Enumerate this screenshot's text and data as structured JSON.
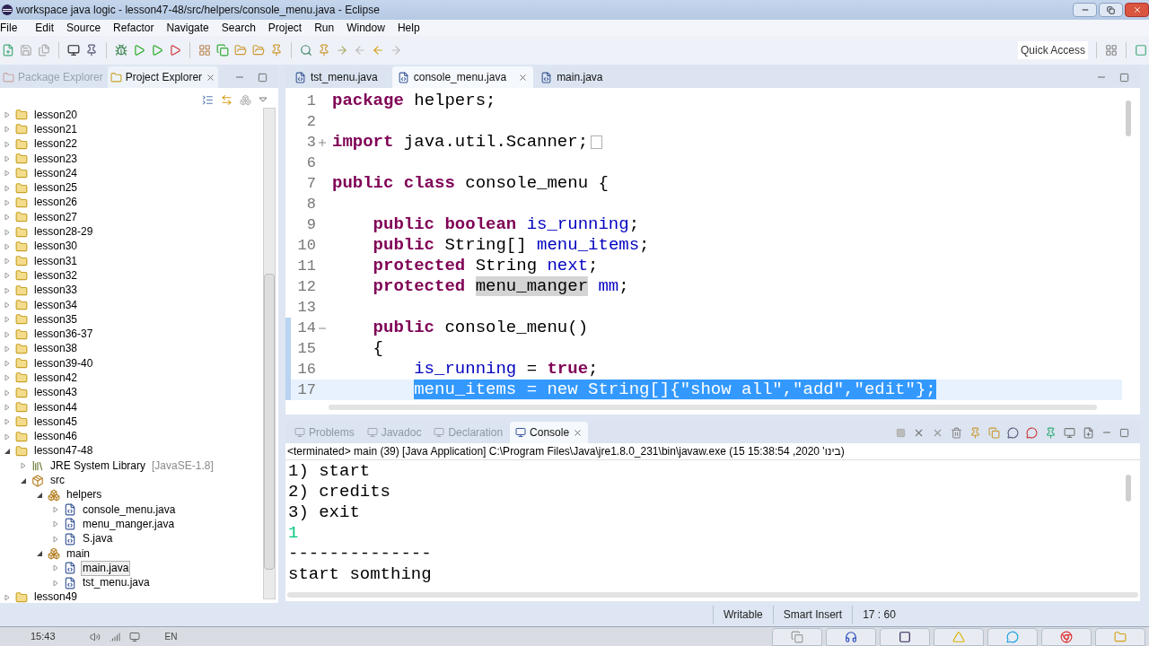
{
  "window": {
    "title": "workspace java logic - lesson47-48/src/helpers/console_menu.java - Eclipse"
  },
  "menu": [
    "File",
    "Edit",
    "Source",
    "Refactor",
    "Navigate",
    "Search",
    "Project",
    "Run",
    "Window",
    "Help"
  ],
  "toolbar": {
    "quick_access": "Quick Access"
  },
  "explorer": {
    "tabs": [
      {
        "label": "Package Explorer",
        "selected": false
      },
      {
        "label": "Project Explorer",
        "selected": true
      }
    ],
    "tree": [
      {
        "label": "lesson20",
        "kind": "project",
        "expanded": false
      },
      {
        "label": "lesson21",
        "kind": "project",
        "expanded": false
      },
      {
        "label": "lesson22",
        "kind": "project",
        "expanded": false
      },
      {
        "label": "lesson23",
        "kind": "project",
        "expanded": false
      },
      {
        "label": "lesson24",
        "kind": "project",
        "expanded": false
      },
      {
        "label": "lesson25",
        "kind": "project",
        "expanded": false
      },
      {
        "label": "lesson26",
        "kind": "project",
        "expanded": false
      },
      {
        "label": "lesson27",
        "kind": "project",
        "expanded": false
      },
      {
        "label": "lesson28-29",
        "kind": "project",
        "expanded": false
      },
      {
        "label": "lesson30",
        "kind": "project",
        "expanded": false
      },
      {
        "label": "lesson31",
        "kind": "project",
        "expanded": false
      },
      {
        "label": "lesson32",
        "kind": "project",
        "expanded": false
      },
      {
        "label": "lesson33",
        "kind": "project",
        "expanded": false
      },
      {
        "label": "lesson34",
        "kind": "project",
        "expanded": false
      },
      {
        "label": "lesson35",
        "kind": "project",
        "expanded": false
      },
      {
        "label": "lesson36-37",
        "kind": "project",
        "expanded": false
      },
      {
        "label": "lesson38",
        "kind": "project",
        "expanded": false
      },
      {
        "label": "lesson39-40",
        "kind": "project",
        "expanded": false
      },
      {
        "label": "lesson42",
        "kind": "project",
        "expanded": false
      },
      {
        "label": "lesson43",
        "kind": "project",
        "expanded": false
      },
      {
        "label": "lesson44",
        "kind": "project",
        "expanded": false
      },
      {
        "label": "lesson45",
        "kind": "project",
        "expanded": false
      },
      {
        "label": "lesson46",
        "kind": "project",
        "expanded": false
      },
      {
        "label": "lesson47-48",
        "kind": "project",
        "expanded": true,
        "children": [
          {
            "label": "JRE System Library",
            "decoration": "[JavaSE-1.8]",
            "kind": "library",
            "expanded": false
          },
          {
            "label": "src",
            "kind": "source",
            "expanded": true,
            "children": [
              {
                "label": "helpers",
                "kind": "package",
                "expanded": true,
                "children": [
                  {
                    "label": "console_menu.java",
                    "kind": "file",
                    "expanded": false,
                    "selected": false
                  },
                  {
                    "label": "menu_manger.java",
                    "kind": "file",
                    "expanded": false,
                    "selected": false
                  },
                  {
                    "label": "S.java",
                    "kind": "file",
                    "expanded": false,
                    "selected": false
                  }
                ]
              },
              {
                "label": "main",
                "kind": "package",
                "expanded": true,
                "children": [
                  {
                    "label": "main.java",
                    "kind": "file",
                    "expanded": false,
                    "selected": true
                  },
                  {
                    "label": "tst_menu.java",
                    "kind": "file",
                    "expanded": false,
                    "selected": false
                  }
                ]
              }
            ]
          }
        ]
      },
      {
        "label": "lesson49",
        "kind": "project",
        "expanded": false
      }
    ]
  },
  "editor": {
    "tabs": [
      {
        "label": "tst_menu.java",
        "selected": false
      },
      {
        "label": "console_menu.java",
        "selected": true
      },
      {
        "label": "main.java",
        "selected": false
      }
    ],
    "lines": [
      {
        "number": "1",
        "tokens": [
          {
            "text": "package",
            "kind": "keyword"
          },
          {
            "text": " helpers;",
            "kind": "plain"
          }
        ]
      },
      {
        "number": "2"
      },
      {
        "number": "3",
        "folded": true,
        "collapsed_box": true,
        "tokens": [
          {
            "text": "import",
            "kind": "keyword"
          },
          {
            "text": " java.util.Scanner;",
            "kind": "plain"
          }
        ]
      },
      {
        "number": "6"
      },
      {
        "number": "7",
        "tokens": [
          {
            "text": "public class",
            "kind": "keyword"
          },
          {
            "text": " console_menu {",
            "kind": "plain"
          }
        ]
      },
      {
        "number": "8"
      },
      {
        "number": "9",
        "tokens": [
          {
            "text": "    public boolean ",
            "kind": "keyword"
          },
          {
            "text": "is_running",
            "kind": "field"
          },
          {
            "text": ";",
            "kind": "plain"
          }
        ]
      },
      {
        "number": "10",
        "tokens": [
          {
            "text": "    public",
            "kind": "keyword"
          },
          {
            "text": " String[] ",
            "kind": "plain"
          },
          {
            "text": "menu_items",
            "kind": "field"
          },
          {
            "text": ";",
            "kind": "plain"
          }
        ]
      },
      {
        "number": "11",
        "tokens": [
          {
            "text": "    protected",
            "kind": "keyword"
          },
          {
            "text": " String ",
            "kind": "plain"
          },
          {
            "text": "next",
            "kind": "field"
          },
          {
            "text": ";",
            "kind": "plain"
          }
        ]
      },
      {
        "number": "12",
        "tokens": [
          {
            "text": "    protected ",
            "kind": "keyword"
          },
          {
            "text": "menu_manger",
            "kind": "occurrence"
          },
          {
            "text": " mm",
            "kind": "field"
          },
          {
            "text": ";",
            "kind": "plain"
          }
        ]
      },
      {
        "number": "13"
      },
      {
        "number": "14",
        "folded": false,
        "changed": true,
        "tokens": [
          {
            "text": "    public",
            "kind": "keyword"
          },
          {
            "text": " console_menu()",
            "kind": "plain"
          }
        ]
      },
      {
        "number": "15",
        "changed": true,
        "tokens": [
          {
            "text": "    {",
            "kind": "plain"
          }
        ]
      },
      {
        "number": "16",
        "changed": true,
        "tokens": [
          {
            "text": "        is_running",
            "kind": "field"
          },
          {
            "text": " = ",
            "kind": "plain"
          },
          {
            "text": "true",
            "kind": "keyword"
          },
          {
            "text": ";",
            "kind": "plain"
          }
        ]
      },
      {
        "number": "17",
        "changed": true,
        "current": true,
        "tokens": [
          {
            "text": "        menu_items = new String[]{\"show all\",\"add\",\"edit\"};",
            "kind": "selection"
          }
        ]
      }
    ]
  },
  "console": {
    "tabs": [
      {
        "label": "Problems",
        "selected": false
      },
      {
        "label": "Javadoc",
        "selected": false
      },
      {
        "label": "Declaration",
        "selected": false
      },
      {
        "label": "Console",
        "selected": true
      }
    ],
    "description": "<terminated> main (39) [Java Application] C:\\Program Files\\Java\\jre1.8.0_231\\bin\\javaw.exe (15 בינו' 2020, 15:38:54)",
    "lines": [
      {
        "text": "1) start",
        "kind": "output"
      },
      {
        "text": "2) credits",
        "kind": "output"
      },
      {
        "text": "3) exit",
        "kind": "output"
      },
      {
        "text": "1",
        "kind": "input"
      },
      {
        "text": "--------------",
        "kind": "output"
      },
      {
        "text": "start somthing",
        "kind": "output"
      }
    ]
  },
  "status_bar": [
    "Writable",
    "Smart Insert",
    "17 : 60"
  ],
  "taskbar": {
    "clock": "15:43",
    "language": "EN"
  }
}
